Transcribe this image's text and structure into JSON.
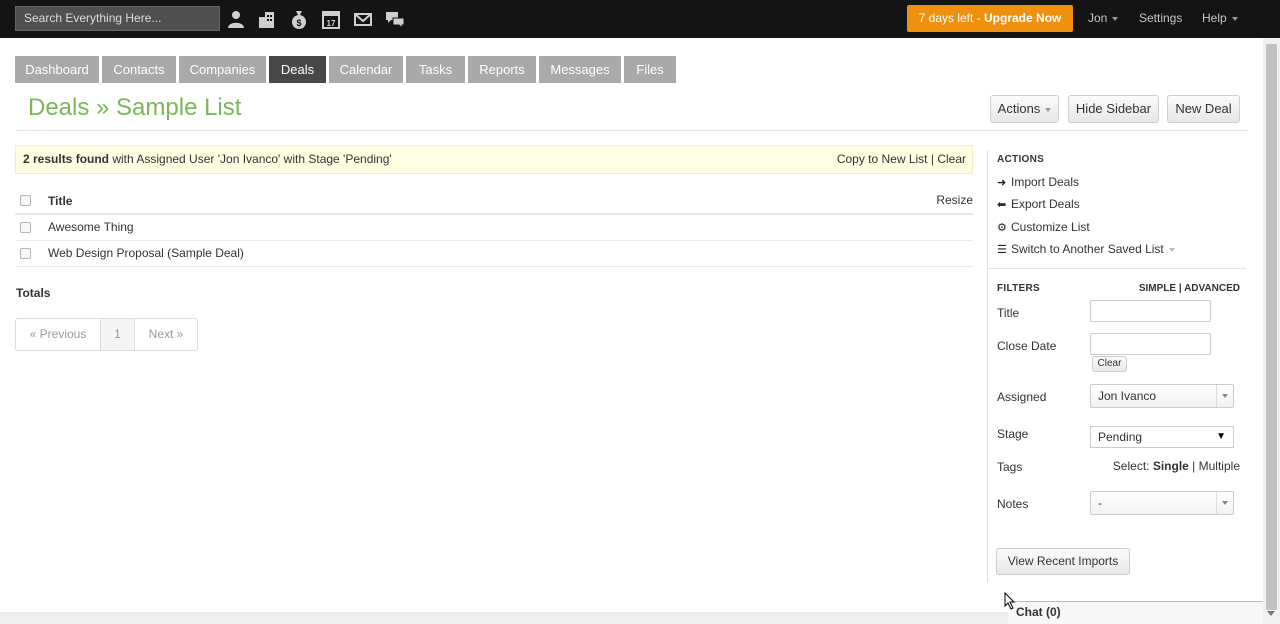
{
  "topbar": {
    "search_placeholder": "Search Everything Here...",
    "icons": [
      "contacts-icon",
      "companies-icon",
      "deals-icon",
      "calendar-icon",
      "messages-icon",
      "chat-icon"
    ],
    "upgrade_days": "7 days left",
    "upgrade_sep": " - ",
    "upgrade_label": "Upgrade Now",
    "user": "Jon",
    "settings": "Settings",
    "help": "Help"
  },
  "tabs": [
    {
      "label": "Dashboard"
    },
    {
      "label": "Contacts"
    },
    {
      "label": "Companies"
    },
    {
      "label": "Deals",
      "active": true
    },
    {
      "label": "Calendar"
    },
    {
      "label": "Tasks"
    },
    {
      "label": "Reports"
    },
    {
      "label": "Messages"
    },
    {
      "label": "Files"
    }
  ],
  "header": {
    "title": "Deals » Sample List",
    "actions_label": "Actions",
    "hide_sidebar_label": "Hide Sidebar",
    "new_deal_label": "New Deal"
  },
  "results": {
    "count": "2 results found",
    "criteria": " with Assigned User 'Jon Ivanco' with Stage 'Pending'",
    "copy_label": "Copy to New List",
    "sep": " | ",
    "clear_label": "Clear"
  },
  "table": {
    "col_title": "Title",
    "resize_label": "Resize",
    "rows": [
      "Awesome Thing",
      "Web Design Proposal (Sample Deal)"
    ]
  },
  "totals_label": "Totals",
  "pager": {
    "prev": "« Previous",
    "page": "1",
    "next": "Next »"
  },
  "sidebar": {
    "actions_heading": "ACTIONS",
    "actions": [
      {
        "icon": "arrow-right-icon",
        "label": "Import Deals"
      },
      {
        "icon": "arrow-left-icon",
        "label": "Export Deals"
      },
      {
        "icon": "gear-icon",
        "label": "Customize List"
      },
      {
        "icon": "list-icon",
        "label": "Switch to Another Saved List"
      }
    ],
    "filters_heading": "FILTERS",
    "simple_label": "SIMPLE",
    "advanced_label": "ADVANCED",
    "filter_labels": {
      "title": "Title",
      "close_date": "Close Date",
      "assigned": "Assigned",
      "stage": "Stage",
      "tags": "Tags",
      "notes": "Notes"
    },
    "title_value": "",
    "close_date_value": "",
    "clear_label": "Clear",
    "assigned_value": "Jon Ivanco",
    "stage_value": "Pending",
    "tags_select_label": "Select:",
    "tags_single": "Single",
    "tags_multiple": "Multiple",
    "notes_value": "-",
    "view_imports_label": "View Recent Imports"
  },
  "chat_label": "Chat (0)",
  "colors": {
    "accent_green": "#79b857",
    "upgrade_orange": "#f0900f",
    "active_tab": "#474747"
  }
}
